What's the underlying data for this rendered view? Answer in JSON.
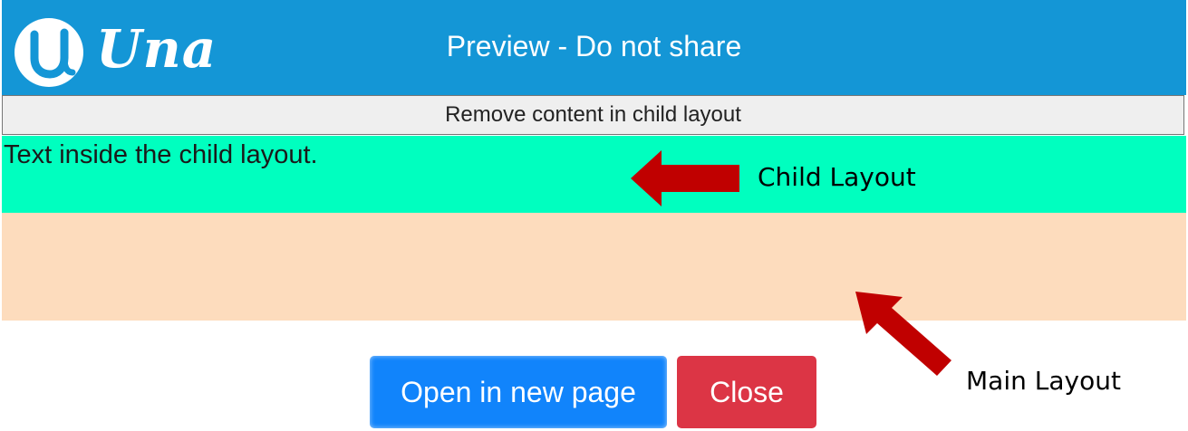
{
  "header": {
    "logo_text": "Una",
    "title": "Preview - Do not share",
    "background_color": "#1496d6"
  },
  "remove_button": {
    "label": "Remove content in child layout"
  },
  "child_layout": {
    "text": "Text inside the child layout.",
    "background_color": "#00ffbf"
  },
  "main_layout": {
    "background_color": "#fddcbd"
  },
  "annotations": {
    "child_label": "Child Layout",
    "main_label": "Main Layout",
    "arrow_color": "#c00000"
  },
  "footer": {
    "open_label": "Open in new page",
    "close_label": "Close",
    "open_color": "#1184fb",
    "close_color": "#dc3545"
  },
  "icons": {
    "logo": "una-logo-icon",
    "child_arrow": "left-arrow-icon",
    "main_arrow": "up-left-arrow-icon"
  }
}
